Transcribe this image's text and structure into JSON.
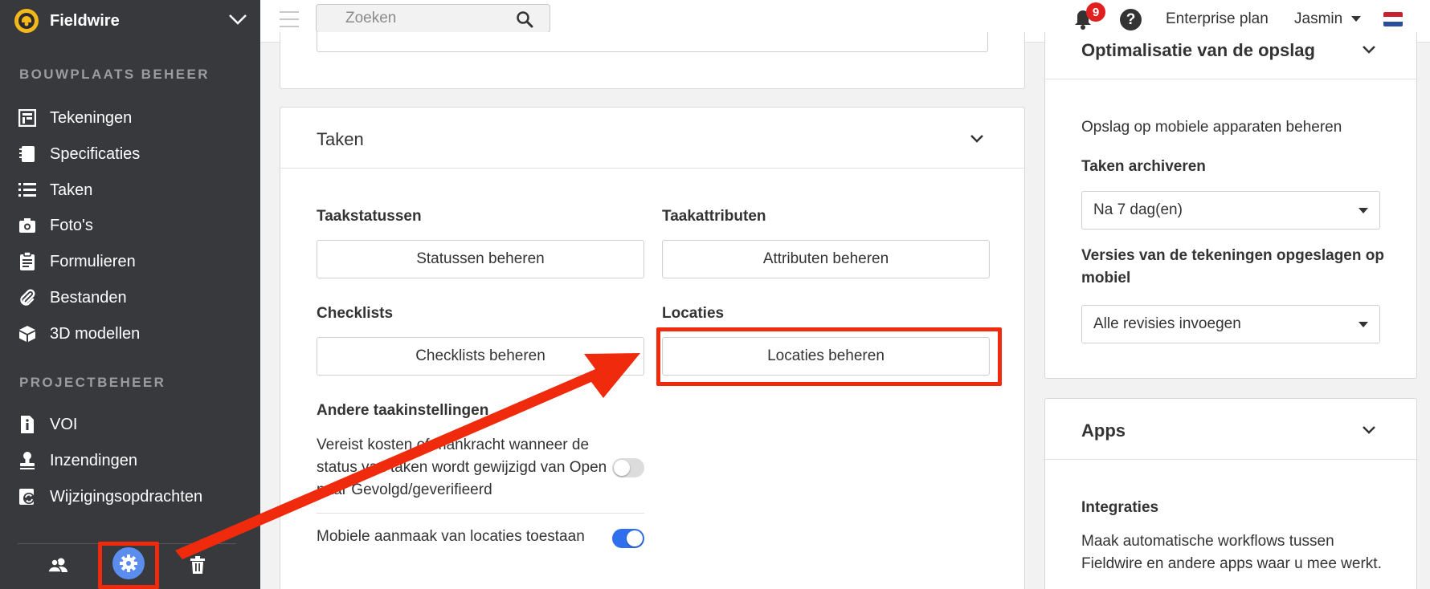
{
  "sidebar": {
    "brand": "Fieldwire",
    "section_site": "BOUWPLAATS BEHEER",
    "site_items": [
      {
        "label": "Tekeningen",
        "icon": "drawing-icon"
      },
      {
        "label": "Specificaties",
        "icon": "notebook-icon"
      },
      {
        "label": "Taken",
        "icon": "list-icon"
      },
      {
        "label": "Foto's",
        "icon": "camera-icon"
      },
      {
        "label": "Formulieren",
        "icon": "clipboard-icon"
      },
      {
        "label": "Bestanden",
        "icon": "paperclip-icon"
      },
      {
        "label": "3D modellen",
        "icon": "cube-icon"
      }
    ],
    "section_project": "PROJECTBEHEER",
    "project_items": [
      {
        "label": "VOI",
        "icon": "info-doc-icon"
      },
      {
        "label": "Inzendingen",
        "icon": "stamp-icon"
      },
      {
        "label": "Wijzigingsopdrachten",
        "icon": "change-order-icon"
      }
    ],
    "footer": [
      "people-icon",
      "gear-icon",
      "trash-icon"
    ]
  },
  "topbar": {
    "search_placeholder": "Zoeken",
    "notification_count": "9",
    "help": "?",
    "plan": "Enterprise plan",
    "user": "Jasmin"
  },
  "tasks_card": {
    "title": "Taken",
    "statuses_label": "Taakstatussen",
    "statuses_button": "Statussen beheren",
    "attributes_label": "Taakattributen",
    "attributes_button": "Attributen beheren",
    "checklists_label": "Checklists",
    "checklists_button": "Checklists beheren",
    "locations_label": "Locaties",
    "locations_button": "Locaties beheren",
    "other_label": "Andere taakinstellingen",
    "require_costs_text": "Vereist kosten of mankracht wanneer de status van taken wordt gewijzigd van Open naar Gevolgd/geverifieerd",
    "require_costs_on": false,
    "mobile_locations_text": "Mobiele aanmaak van locaties toestaan",
    "mobile_locations_on": true
  },
  "storage_card": {
    "title": "Optimalisatie van de opslag",
    "description": "Opslag op mobiele apparaten beheren",
    "archive_label": "Taken archiveren",
    "archive_value": "Na 7 dag(en)",
    "versions_label": "Versies van de tekeningen opgeslagen op mobiel",
    "versions_value": "Alle revisies invoegen"
  },
  "apps_card": {
    "title": "Apps",
    "integrations_label": "Integraties",
    "integrations_text": "Maak automatische workflows tussen Fieldwire en andere apps waar u mee werkt."
  },
  "colors": {
    "sidebar": "#37393d",
    "accent_blue": "#2f6fed",
    "annotation_red": "#f02a0c",
    "brand_yellow": "#f3b81b"
  }
}
